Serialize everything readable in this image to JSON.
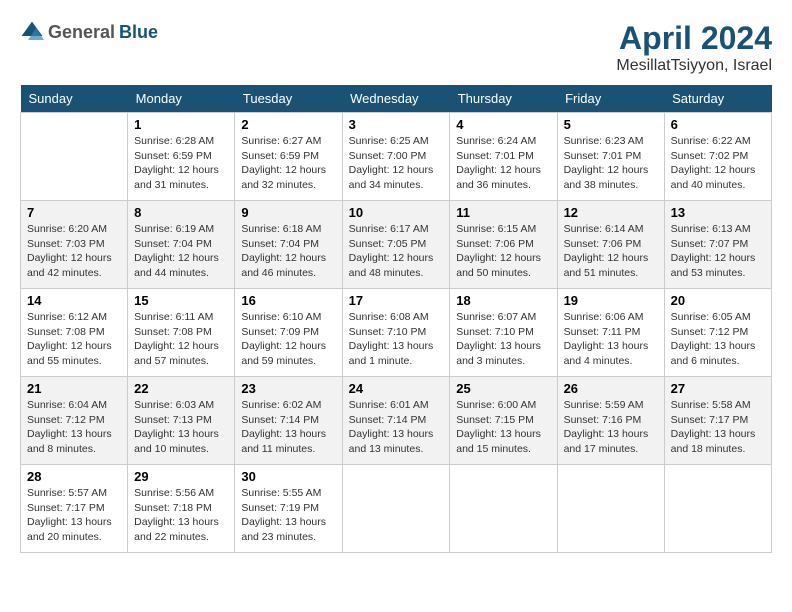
{
  "header": {
    "logo_general": "General",
    "logo_blue": "Blue",
    "month_year": "April 2024",
    "location": "MesillatTsiyyon, Israel"
  },
  "days_of_week": [
    "Sunday",
    "Monday",
    "Tuesday",
    "Wednesday",
    "Thursday",
    "Friday",
    "Saturday"
  ],
  "weeks": [
    [
      {
        "day": "",
        "info": ""
      },
      {
        "day": "1",
        "info": "Sunrise: 6:28 AM\nSunset: 6:59 PM\nDaylight: 12 hours\nand 31 minutes."
      },
      {
        "day": "2",
        "info": "Sunrise: 6:27 AM\nSunset: 6:59 PM\nDaylight: 12 hours\nand 32 minutes."
      },
      {
        "day": "3",
        "info": "Sunrise: 6:25 AM\nSunset: 7:00 PM\nDaylight: 12 hours\nand 34 minutes."
      },
      {
        "day": "4",
        "info": "Sunrise: 6:24 AM\nSunset: 7:01 PM\nDaylight: 12 hours\nand 36 minutes."
      },
      {
        "day": "5",
        "info": "Sunrise: 6:23 AM\nSunset: 7:01 PM\nDaylight: 12 hours\nand 38 minutes."
      },
      {
        "day": "6",
        "info": "Sunrise: 6:22 AM\nSunset: 7:02 PM\nDaylight: 12 hours\nand 40 minutes."
      }
    ],
    [
      {
        "day": "7",
        "info": "Sunrise: 6:20 AM\nSunset: 7:03 PM\nDaylight: 12 hours\nand 42 minutes."
      },
      {
        "day": "8",
        "info": "Sunrise: 6:19 AM\nSunset: 7:04 PM\nDaylight: 12 hours\nand 44 minutes."
      },
      {
        "day": "9",
        "info": "Sunrise: 6:18 AM\nSunset: 7:04 PM\nDaylight: 12 hours\nand 46 minutes."
      },
      {
        "day": "10",
        "info": "Sunrise: 6:17 AM\nSunset: 7:05 PM\nDaylight: 12 hours\nand 48 minutes."
      },
      {
        "day": "11",
        "info": "Sunrise: 6:15 AM\nSunset: 7:06 PM\nDaylight: 12 hours\nand 50 minutes."
      },
      {
        "day": "12",
        "info": "Sunrise: 6:14 AM\nSunset: 7:06 PM\nDaylight: 12 hours\nand 51 minutes."
      },
      {
        "day": "13",
        "info": "Sunrise: 6:13 AM\nSunset: 7:07 PM\nDaylight: 12 hours\nand 53 minutes."
      }
    ],
    [
      {
        "day": "14",
        "info": "Sunrise: 6:12 AM\nSunset: 7:08 PM\nDaylight: 12 hours\nand 55 minutes."
      },
      {
        "day": "15",
        "info": "Sunrise: 6:11 AM\nSunset: 7:08 PM\nDaylight: 12 hours\nand 57 minutes."
      },
      {
        "day": "16",
        "info": "Sunrise: 6:10 AM\nSunset: 7:09 PM\nDaylight: 12 hours\nand 59 minutes."
      },
      {
        "day": "17",
        "info": "Sunrise: 6:08 AM\nSunset: 7:10 PM\nDaylight: 13 hours\nand 1 minute."
      },
      {
        "day": "18",
        "info": "Sunrise: 6:07 AM\nSunset: 7:10 PM\nDaylight: 13 hours\nand 3 minutes."
      },
      {
        "day": "19",
        "info": "Sunrise: 6:06 AM\nSunset: 7:11 PM\nDaylight: 13 hours\nand 4 minutes."
      },
      {
        "day": "20",
        "info": "Sunrise: 6:05 AM\nSunset: 7:12 PM\nDaylight: 13 hours\nand 6 minutes."
      }
    ],
    [
      {
        "day": "21",
        "info": "Sunrise: 6:04 AM\nSunset: 7:12 PM\nDaylight: 13 hours\nand 8 minutes."
      },
      {
        "day": "22",
        "info": "Sunrise: 6:03 AM\nSunset: 7:13 PM\nDaylight: 13 hours\nand 10 minutes."
      },
      {
        "day": "23",
        "info": "Sunrise: 6:02 AM\nSunset: 7:14 PM\nDaylight: 13 hours\nand 11 minutes."
      },
      {
        "day": "24",
        "info": "Sunrise: 6:01 AM\nSunset: 7:14 PM\nDaylight: 13 hours\nand 13 minutes."
      },
      {
        "day": "25",
        "info": "Sunrise: 6:00 AM\nSunset: 7:15 PM\nDaylight: 13 hours\nand 15 minutes."
      },
      {
        "day": "26",
        "info": "Sunrise: 5:59 AM\nSunset: 7:16 PM\nDaylight: 13 hours\nand 17 minutes."
      },
      {
        "day": "27",
        "info": "Sunrise: 5:58 AM\nSunset: 7:17 PM\nDaylight: 13 hours\nand 18 minutes."
      }
    ],
    [
      {
        "day": "28",
        "info": "Sunrise: 5:57 AM\nSunset: 7:17 PM\nDaylight: 13 hours\nand 20 minutes."
      },
      {
        "day": "29",
        "info": "Sunrise: 5:56 AM\nSunset: 7:18 PM\nDaylight: 13 hours\nand 22 minutes."
      },
      {
        "day": "30",
        "info": "Sunrise: 5:55 AM\nSunset: 7:19 PM\nDaylight: 13 hours\nand 23 minutes."
      },
      {
        "day": "",
        "info": ""
      },
      {
        "day": "",
        "info": ""
      },
      {
        "day": "",
        "info": ""
      },
      {
        "day": "",
        "info": ""
      }
    ]
  ]
}
